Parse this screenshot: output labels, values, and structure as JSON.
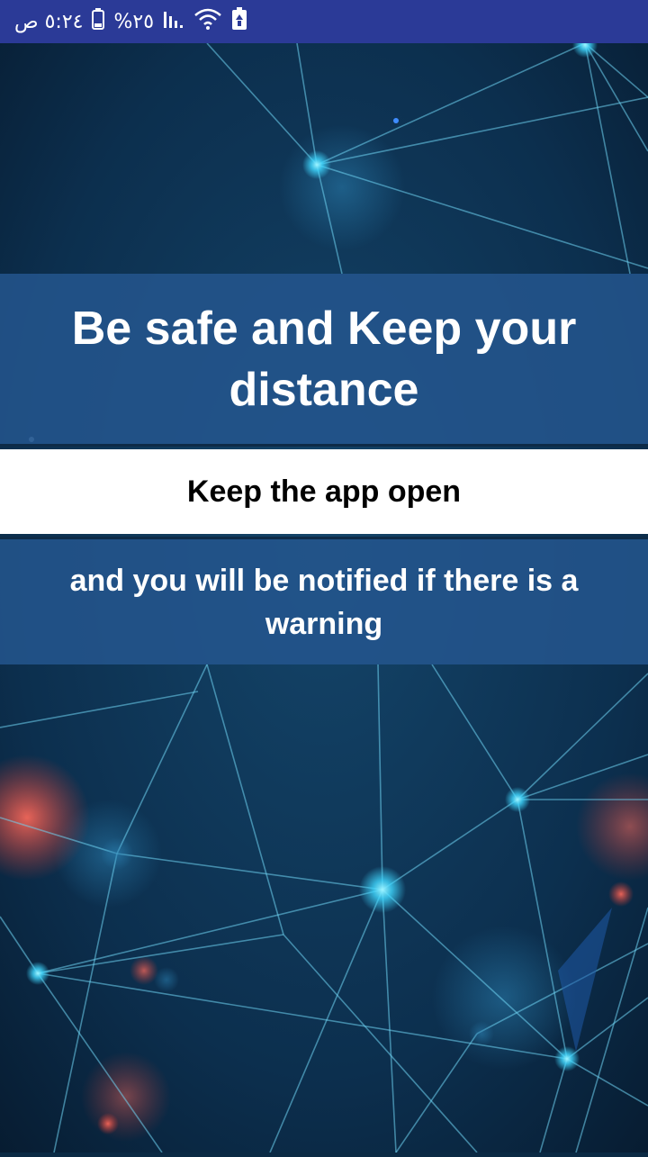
{
  "status_bar": {
    "time": "٥:٢٤ ص",
    "battery_percent": "%٢٥",
    "icons": [
      "battery-icon",
      "signal-icon",
      "wifi-icon",
      "battery-saver-icon"
    ],
    "background": "#2b3a97"
  },
  "main": {
    "headline": "Be safe and Keep your distance",
    "instruction": "Keep the app open",
    "notice": "and you will be notified if there is a warning"
  },
  "colors": {
    "band_blue": "#24568e",
    "background_dark": "#0b2a44",
    "node_cyan": "#3fd7ff",
    "node_red": "#e0392e"
  }
}
